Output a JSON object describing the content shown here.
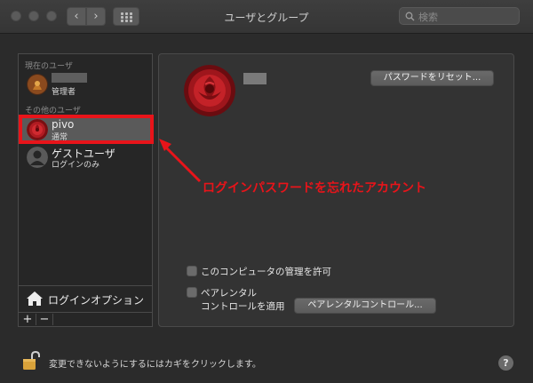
{
  "window": {
    "title": "ユーザとグループ",
    "search_placeholder": "検索",
    "back_glyph": "‹",
    "forward_glyph": "›"
  },
  "sidebar": {
    "current_user_header": "現在のユーザ",
    "current_user": {
      "name": "",
      "role": "管理者"
    },
    "other_users_header": "その他のユーザ",
    "users": [
      {
        "name": "pivo",
        "role": "通常",
        "selected": true
      },
      {
        "name": "ゲストユーザ",
        "role": "ログインのみ",
        "selected": false
      }
    ],
    "login_options_label": "ログインオプション",
    "add_label": "+",
    "remove_label": "−"
  },
  "main": {
    "reset_password_button": "パスワードをリセット...",
    "allow_admin_label": "このコンピュータの管理を許可",
    "parental_label_line1": "ペアレンタル",
    "parental_label_line2": "コントロールを適用",
    "parental_button": "ペアレンタルコントロール...",
    "allow_admin_checked": false,
    "parental_checked": false
  },
  "annotation": {
    "text": "ログインパスワードを忘れたアカウント",
    "color": "#e8141a"
  },
  "footer": {
    "lock_message": "変更できないようにするにはカギをクリックします。",
    "help_label": "?"
  }
}
